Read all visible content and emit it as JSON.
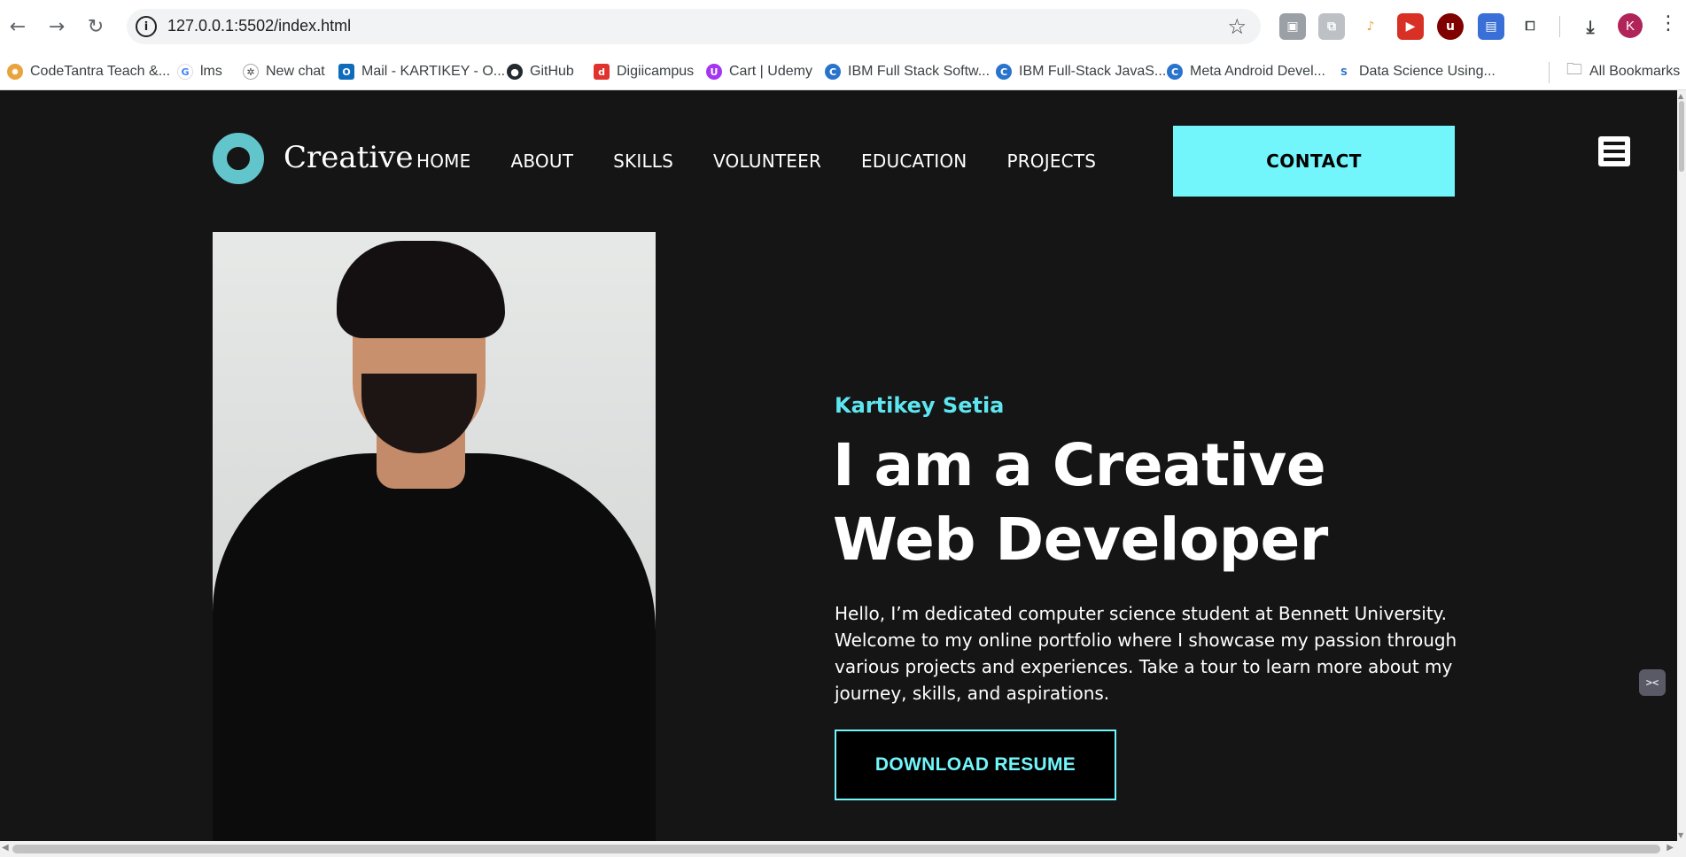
{
  "browser": {
    "url": "127.0.0.1:5502/index.html",
    "profile_initial": "K",
    "bookmarks": [
      {
        "label": "CodeTantra Teach &...",
        "icon": "codetantra-icon",
        "color": "#e8a33d"
      },
      {
        "label": "lms",
        "icon": "google-icon",
        "color": "#4285f4"
      },
      {
        "label": "New chat",
        "icon": "openai-icon",
        "color": "#3c4043"
      },
      {
        "label": "Mail - KARTIKEY - O...",
        "icon": "outlook-icon",
        "color": "#0f6cbd"
      },
      {
        "label": "GitHub",
        "icon": "github-icon",
        "color": "#24292f"
      },
      {
        "label": "Digiicampus",
        "icon": "digiicampus-icon",
        "color": "#e0332d"
      },
      {
        "label": "Cart | Udemy",
        "icon": "udemy-icon",
        "color": "#a435f0"
      },
      {
        "label": "IBM Full Stack Softw...",
        "icon": "coursera-icon",
        "color": "#2a73cc"
      },
      {
        "label": "IBM Full-Stack JavaS...",
        "icon": "coursera-icon",
        "color": "#2a73cc"
      },
      {
        "label": "Meta Android Devel...",
        "icon": "coursera-icon",
        "color": "#2a73cc"
      },
      {
        "label": "Data Science Using...",
        "icon": "s-icon",
        "color": "#2a73cc"
      }
    ],
    "all_bookmarks": "All Bookmarks"
  },
  "site": {
    "logo_text": "Creative",
    "nav": [
      "HOME",
      "ABOUT",
      "SKILLS",
      "VOLUNTEER",
      "EDUCATION",
      "PROJECTS"
    ],
    "contact_label": "CONTACT",
    "hero": {
      "name": "Kartikey Setia",
      "headline_line1": "I am a Creative",
      "headline_line2": "Web Developer",
      "bio": "Hello, I’m dedicated computer science student at Bennett University. Welcome to my online portfolio where I showcase my passion through various projects and experiences. Take a tour to learn more about my journey, skills, and aspirations.",
      "resume_label": "DOWNLOAD RESUME"
    },
    "colors": {
      "background": "#151515",
      "accent": "#72f6fb",
      "logo_ring": "#63c5cc",
      "name_color": "#5ee6f0"
    }
  }
}
